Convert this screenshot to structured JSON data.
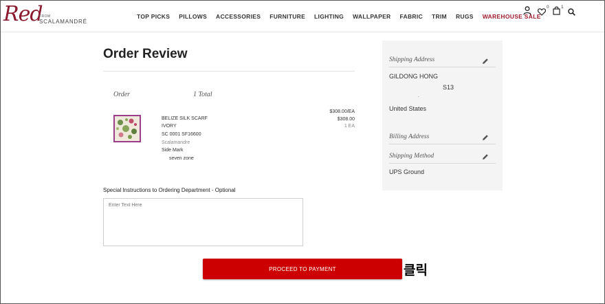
{
  "brand": {
    "logo_word": "Red",
    "logo_from": "FROM",
    "logo_name": "SCALAMANDRÉ"
  },
  "nav": {
    "items": [
      "TOP PICKS",
      "PILLOWS",
      "ACCESSORIES",
      "FURNITURE",
      "LIGHTING",
      "WALLPAPER",
      "FABRIC",
      "TRIM",
      "RUGS"
    ],
    "sale": "WAREHOUSE SALE"
  },
  "header_icons": {
    "account_icon": "user-icon",
    "wishlist_icon": "heart-icon",
    "wishlist_count": "0",
    "cart_icon": "bag-icon",
    "cart_count": "1",
    "search_icon": "search-icon"
  },
  "order": {
    "title": "Order Review",
    "order_label": "Order",
    "total_label": "1 Total",
    "item": {
      "name": "BELIZE SILK SCARF",
      "color": "IVORY",
      "sku": "SC 0001 SF16600",
      "brand": "Scalamandre",
      "side_mark_label": "Side Mark",
      "side_mark_value": "seven zone",
      "unit_price": "$308.00/EA",
      "line_total": "$308.00",
      "quantity": "1 EA"
    }
  },
  "instructions": {
    "label": "Special Instructions to Ordering Department - Optional",
    "placeholder": "Enter Text Here",
    "value": ""
  },
  "actions": {
    "proceed_label": "PROCEED TO PAYMENT",
    "annotation": "클릭"
  },
  "summary": {
    "shipping_address": {
      "heading": "Shipping Address",
      "name": "GILDONG HONG",
      "line2": "S13",
      "line3": ".",
      "country": "United States"
    },
    "billing_address": {
      "heading": "Billing Address"
    },
    "shipping_method": {
      "heading": "Shipping Method",
      "value": "UPS Ground"
    }
  },
  "colors": {
    "accent_red": "#cc0000",
    "sale_red": "#a01c2c",
    "logo_red": "#8b1a2e",
    "panel_bg": "#f4f4f4"
  }
}
